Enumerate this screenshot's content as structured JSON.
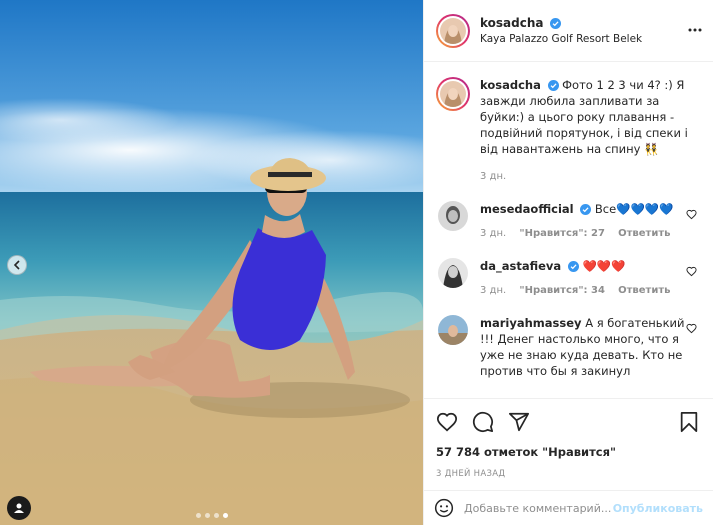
{
  "post": {
    "username": "kosadcha",
    "location": "Kaya Palazzo Golf Resort Belek"
  },
  "caption": {
    "username": "kosadcha",
    "text": "Фото 1 2 3 чи 4? :) Я завжди любила запливати за буйки:) а цього року плавання - подвійний порятунок, і від спеки і від навантажень на спину 👯",
    "time": "3 дн."
  },
  "comments": [
    {
      "username": "mesedaofficial",
      "text": "Все💙💙💙💙",
      "time": "3 дн.",
      "likes": "\"Нравится\": 27",
      "reply": "Ответить"
    },
    {
      "username": "da_astafieva",
      "text": "❤️❤️❤️",
      "time": "3 дн.",
      "likes": "\"Нравится\": 34",
      "reply": "Ответить"
    },
    {
      "username": "mariyahmassey",
      "text": "А я богатенький !!! Денег настолько много, что я уже не знаю куда девать. Кто не против что бы я закинул"
    }
  ],
  "likes_text": "57 784 отметок \"Нравится\"",
  "date_text": "3 ДНЕЙ НАЗАД",
  "add_comment": {
    "placeholder": "Добавьте комментарий...",
    "publish_label": "Опубликовать"
  },
  "carousel": {
    "total": 4,
    "current": 4
  },
  "colors": {
    "verified": "#3897f0",
    "link_disabled": "#b2dffc",
    "muted_text": "#8e8e8e",
    "swimsuit": "#3a2fd6"
  },
  "icons": [
    "more-icon",
    "heart-icon",
    "comment-icon",
    "share-icon",
    "bookmark-icon",
    "emoji-icon",
    "chevron-left-icon",
    "user-tag-icon",
    "verified-icon"
  ]
}
